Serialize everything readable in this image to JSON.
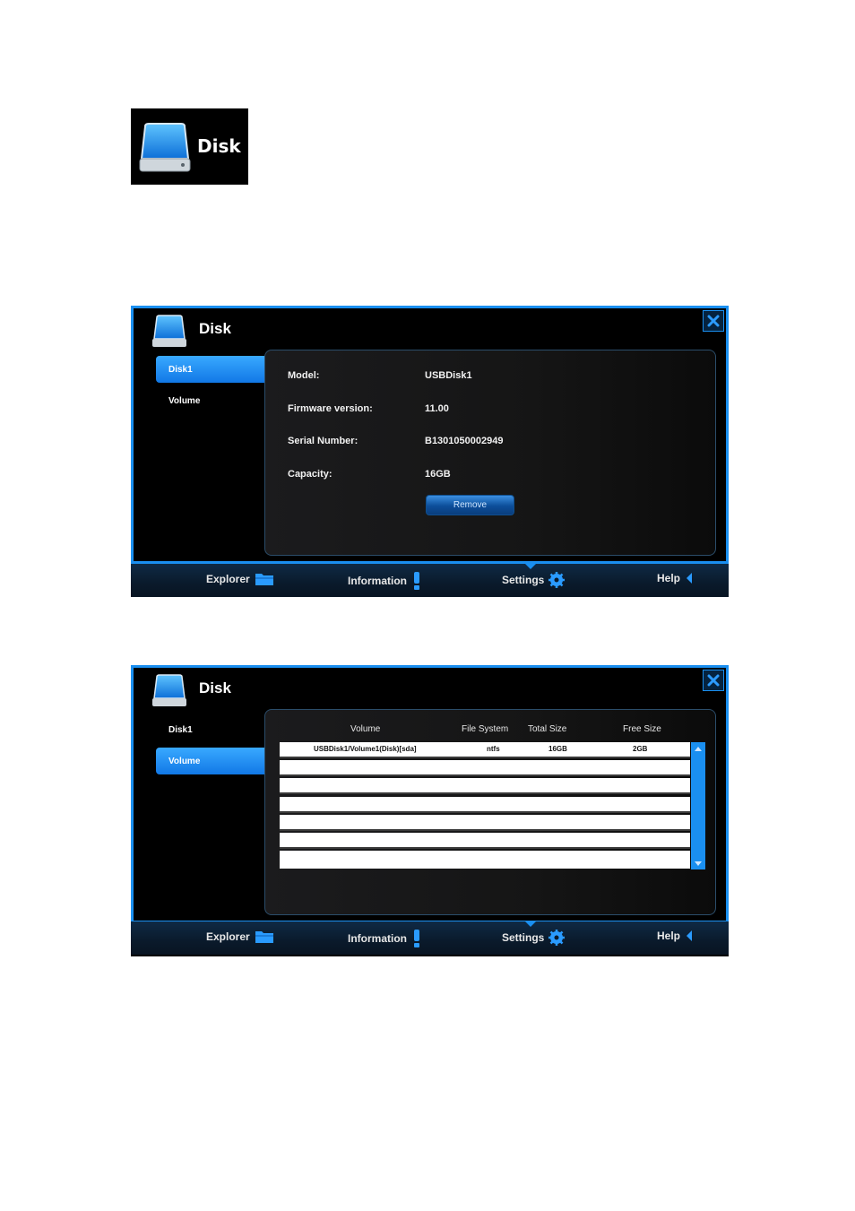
{
  "tile": {
    "label": "Disk"
  },
  "window1": {
    "title": "Disk",
    "sidebar": [
      {
        "label": "Disk1",
        "active": true
      },
      {
        "label": "Volume",
        "active": false
      }
    ],
    "info": [
      {
        "label": "Model:",
        "value": "USBDisk1"
      },
      {
        "label": "Firmware version:",
        "value": "11.00"
      },
      {
        "label": "Serial Number:",
        "value": "B1301050002949"
      },
      {
        "label": "Capacity:",
        "value": "16GB"
      }
    ],
    "remove_label": "Remove"
  },
  "window2": {
    "title": "Disk",
    "sidebar": [
      {
        "label": "Disk1",
        "active": false
      },
      {
        "label": "Volume",
        "active": true
      }
    ],
    "table": {
      "columns": [
        "Volume",
        "File System",
        "Total Size",
        "Free Size"
      ],
      "rows": [
        [
          "USBDisk1/Volume1(Disk)[sda]",
          "ntfs",
          "16GB",
          "2GB"
        ],
        [
          "",
          "",
          "",
          ""
        ],
        [
          "",
          "",
          "",
          ""
        ],
        [
          "",
          "",
          "",
          ""
        ],
        [
          "",
          "",
          "",
          ""
        ],
        [
          "",
          "",
          "",
          ""
        ],
        [
          "",
          "",
          "",
          ""
        ]
      ]
    }
  },
  "nav": {
    "explorer": "Explorer",
    "information": "Information",
    "settings": "Settings",
    "help": "Help"
  },
  "colors": {
    "accent": "#1a8ff0",
    "background": "#000000",
    "nav": "#0a1a2b"
  },
  "icons": [
    "disk-icon",
    "close-icon",
    "folder-icon",
    "exclamation-icon",
    "gear-icon",
    "back-arrow-icon"
  ]
}
